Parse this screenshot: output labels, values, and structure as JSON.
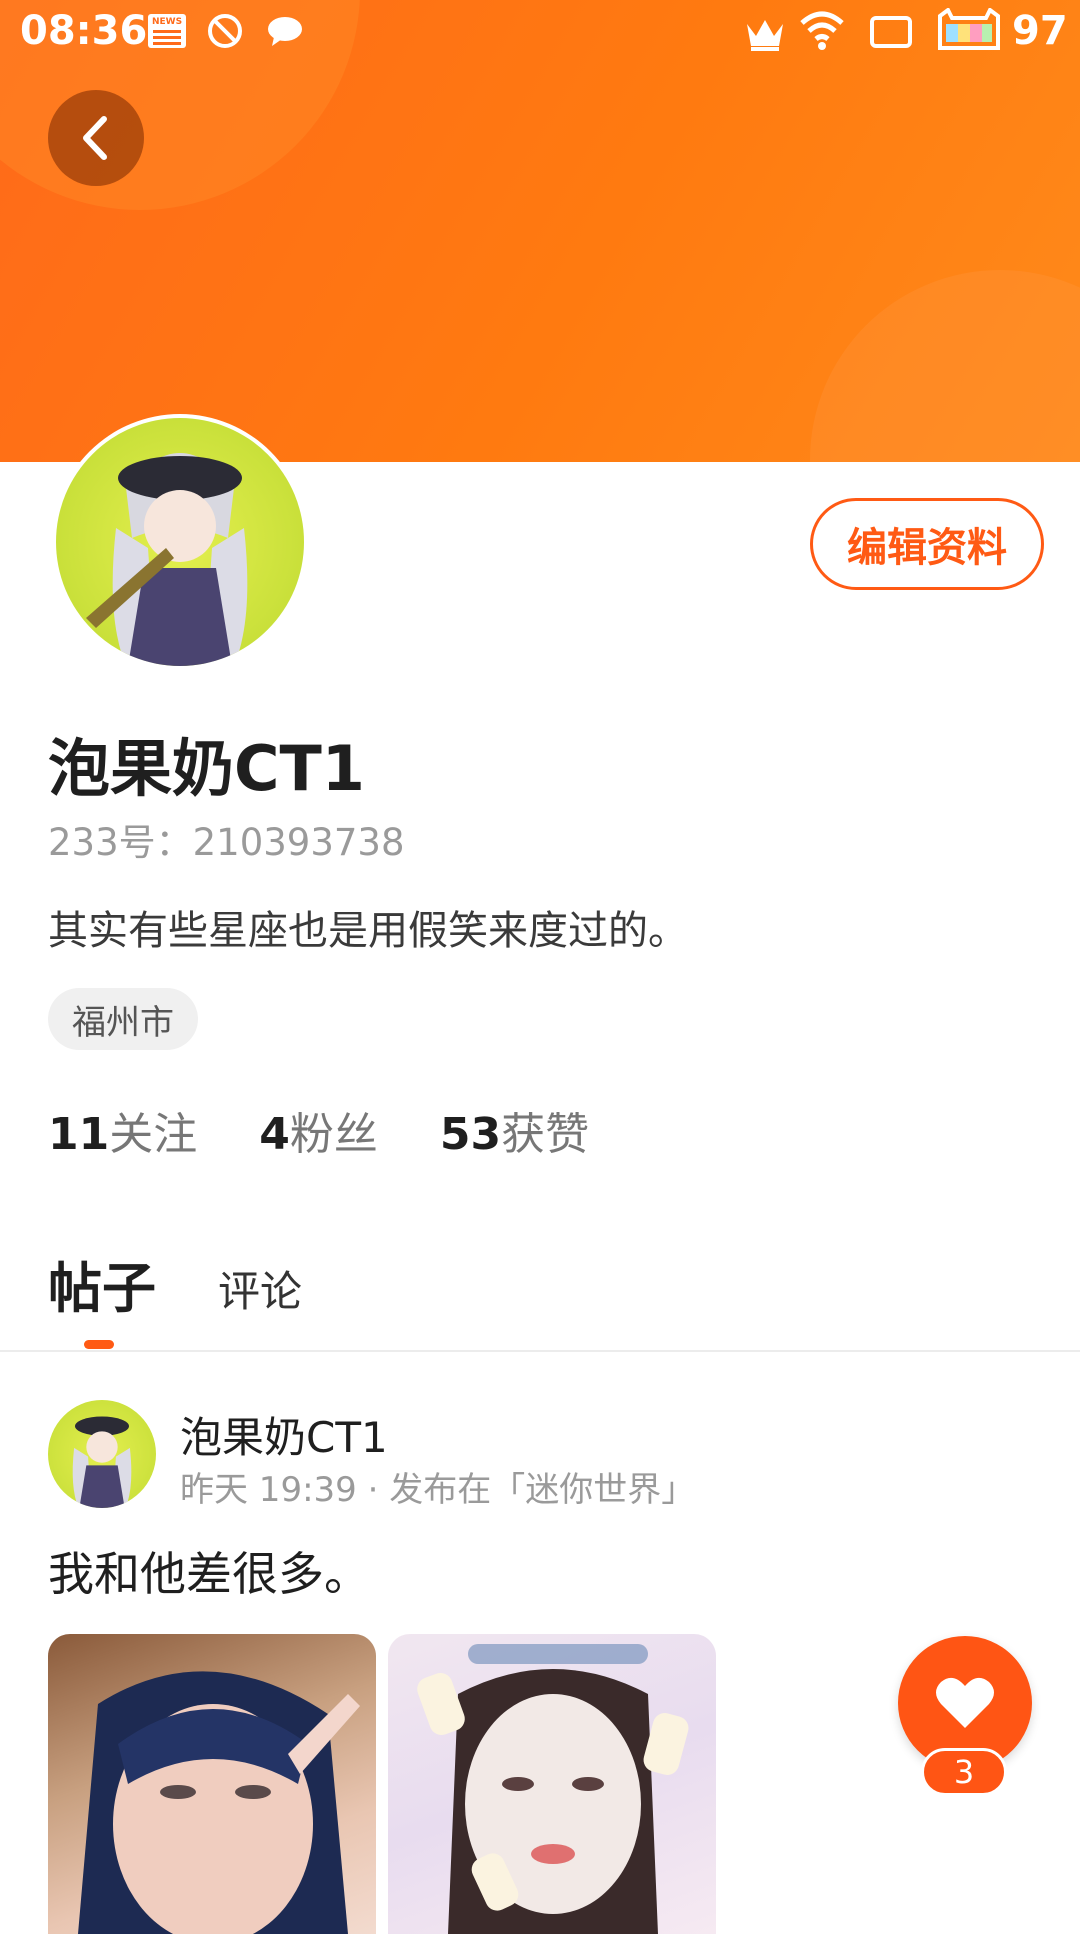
{
  "status_bar": {
    "time": "08:36",
    "battery": "97"
  },
  "profile": {
    "name": "泡果奶CT1",
    "id_line": "233号：210393738",
    "bio": "其实有些星座也是用假笑来度过的。",
    "location": "福州市",
    "edit_label": "编辑资料",
    "stats": [
      {
        "num": "11",
        "label": "关注"
      },
      {
        "num": "4",
        "label": "粉丝"
      },
      {
        "num": "53",
        "label": "获赞"
      }
    ]
  },
  "tabs": [
    {
      "label": "帖子",
      "active": true
    },
    {
      "label": "评论",
      "active": false
    }
  ],
  "post": {
    "author": "泡果奶CT1",
    "meta": "昨天 19:39 · 发布在「迷你世界」",
    "text": "我和他差很多。"
  },
  "like": {
    "count": "3"
  },
  "colors": {
    "accent": "#ff5514",
    "banner": "#ff7a10"
  },
  "icons": [
    "back-arrow-icon",
    "news-icon",
    "no-disturb-icon",
    "message-icon",
    "crown-icon",
    "wifi-icon",
    "sim-icon",
    "battery-icon",
    "heart-icon"
  ]
}
